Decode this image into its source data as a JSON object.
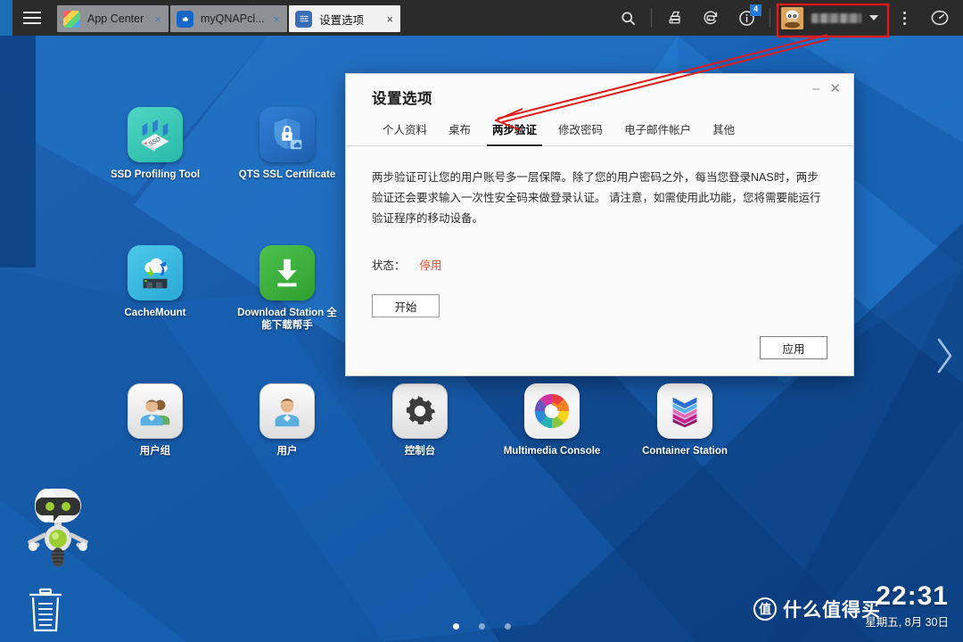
{
  "taskbar": {
    "menu_icon": "hamburger-menu-icon",
    "tabs": [
      {
        "label": "App Center",
        "icon": "app-center-icon",
        "close": "×",
        "active": false
      },
      {
        "label": "myQNAPcl...",
        "icon": "myqnapcloud-icon",
        "close": "×",
        "active": false
      },
      {
        "label": "设置选项",
        "icon": "settings-icon",
        "close": "×",
        "active": true
      }
    ],
    "right_icons": [
      {
        "name": "search-icon"
      },
      {
        "name": "storage-volume-icon"
      },
      {
        "name": "backup-sync-icon"
      },
      {
        "name": "notification-info-icon",
        "badge": "4"
      }
    ],
    "user": {
      "name_blurred": true,
      "avatar": "user-avatar",
      "caret": "▾"
    },
    "more_icon": "more-options-icon",
    "dashboard_icon": "dashboard-gauge-icon"
  },
  "desktop": {
    "icons": [
      {
        "label": "SSD Profiling Tool",
        "icon": "ssd-profiling-tool-icon"
      },
      {
        "label": "QTS SSL Certificate",
        "icon": "qts-ssl-certificate-icon"
      },
      {
        "label": "CacheMount",
        "icon": "cachemount-icon"
      },
      {
        "label": "Download Station 全能下载帮手",
        "icon": "download-station-icon"
      },
      {
        "label": "用户组",
        "icon": "user-groups-icon"
      },
      {
        "label": "用户",
        "icon": "users-icon"
      },
      {
        "label": "控制台",
        "icon": "control-panel-icon"
      },
      {
        "label": "Multimedia Console",
        "icon": "multimedia-console-icon"
      },
      {
        "label": "Container Station",
        "icon": "container-station-icon"
      }
    ],
    "robot": "qboost-robot-icon",
    "trash": "recycle-bin-icon",
    "page_dots": {
      "count": 3,
      "active_index": 0
    },
    "next_page_icon": "chevron-right-icon"
  },
  "dialog": {
    "title": "设置选项",
    "minimize": "–",
    "close": "✕",
    "tabs": [
      {
        "label": "个人资料",
        "active": false
      },
      {
        "label": "桌布",
        "active": false
      },
      {
        "label": "两步验证",
        "active": true
      },
      {
        "label": "修改密码",
        "active": false
      },
      {
        "label": "电子邮件帐户",
        "active": false
      },
      {
        "label": "其他",
        "active": false
      }
    ],
    "description": "两步验证可让您的用户账号多一层保障。除了您的用户密码之外，每当您登录NAS时，两步验证还会要求输入一次性安全码来做登录认证。 请注意，如需使用此功能，您将需要能运行验证程序的移动设备。",
    "status_label": "状态：",
    "status_value": "停用",
    "start_button": "开始",
    "apply_button": "应用"
  },
  "clock": {
    "time": "22:31",
    "date": "星期五, 8月 30日"
  },
  "watermark": {
    "logo": "值",
    "text": "什么值得买"
  },
  "annotation": {
    "highlight_box": "user-menu-highlight",
    "arrow": "annotation-arrow",
    "color": "#e01b1b"
  },
  "colors": {
    "taskbar_bg": "#2b2b2b",
    "desktop_blue": "#1259a8",
    "accent_blue": "#1f7ae0",
    "status_red": "#d8472b",
    "annotation_red": "#e01b1b"
  }
}
